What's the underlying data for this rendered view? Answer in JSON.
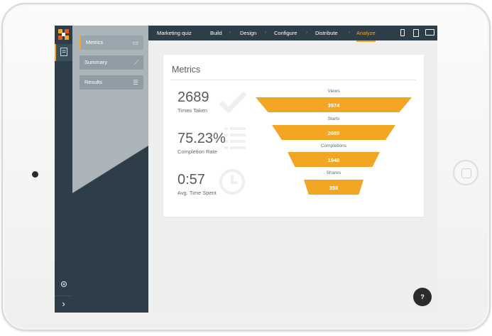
{
  "sidebar": {
    "items": [
      {
        "label": "Metrics",
        "icon": "image-icon"
      },
      {
        "label": "Summary",
        "icon": "chart-icon"
      },
      {
        "label": "Results",
        "icon": "list-icon"
      }
    ]
  },
  "topbar": {
    "title": "Marketing quiz",
    "tabs": [
      "Build",
      "Design",
      "Configure",
      "Distribute",
      "Analyze"
    ],
    "active_tab": "Analyze",
    "device_icons": [
      "phone-icon",
      "tablet-icon",
      "desktop-icon"
    ]
  },
  "metrics": {
    "title": "Metrics",
    "items": [
      {
        "value": "2689",
        "label": "Times Taken",
        "icon": "check-icon"
      },
      {
        "value": "75.23%",
        "label": "Completion Rate",
        "icon": "list-icon"
      },
      {
        "value": "0:57",
        "label": "Avg. Time Spent",
        "icon": "clock-icon"
      }
    ]
  },
  "funnel": [
    {
      "label": "Views",
      "value": "3574"
    },
    {
      "label": "Starts",
      "value": "2689"
    },
    {
      "label": "Completions",
      "value": "1948"
    },
    {
      "label": "Shares",
      "value": "358"
    }
  ],
  "help_button": "?",
  "colors": {
    "accent": "#f5a623",
    "navy": "#2d3e48",
    "funnel": "#f2a623"
  }
}
